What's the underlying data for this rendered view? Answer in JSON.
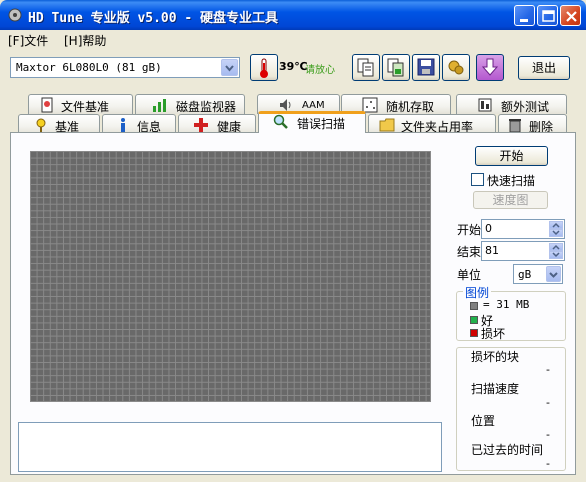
{
  "window": {
    "title": "HD Tune 专业版 v5.00 - 硬盘专业工具"
  },
  "menu": [
    {
      "label": "[F]文件"
    },
    {
      "label": "[H]帮助"
    }
  ],
  "toolbar": {
    "drive": "Maxtor 6L080L0 (81 gB)",
    "temperature": "39℃",
    "temperature_status": "请放心",
    "exit_label": "退出"
  },
  "tabs_top": [
    {
      "label": "文件基准",
      "icon": "file-benchmark-icon"
    },
    {
      "label": "磁盘监视器",
      "icon": "disk-monitor-icon"
    },
    {
      "label": "AAM",
      "icon": "speaker-icon"
    },
    {
      "label": "随机存取",
      "icon": "random-access-icon"
    },
    {
      "label": "额外测试",
      "icon": "extra-tests-icon"
    }
  ],
  "tabs_bottom": [
    {
      "label": "基准",
      "icon": "benchmark-icon"
    },
    {
      "label": "信息",
      "icon": "info-icon"
    },
    {
      "label": "健康",
      "icon": "health-icon"
    },
    {
      "label": "错误扫描",
      "icon": "magnifier-icon",
      "active": true
    },
    {
      "label": "文件夹占用率",
      "icon": "folder-icon"
    },
    {
      "label": "删除",
      "icon": "trash-icon"
    }
  ],
  "scan": {
    "start_button": "开始",
    "quick_scan_label": "快速扫描",
    "quick_scan_checked": false,
    "speed_map_button": "速度图",
    "start_label": "开始",
    "start_value": "0",
    "end_label": "结束",
    "end_value": "81",
    "unit_label": "单位",
    "unit_value": "gB"
  },
  "legend": {
    "title": "图例",
    "block_size": "= 31 MB",
    "good": "好",
    "bad": "损坏",
    "colors": {
      "block": "#808080",
      "good": "#22b14c",
      "bad": "#d00000"
    }
  },
  "stats": {
    "damaged_blocks_label": "损坏的块",
    "damaged_blocks_value": "-",
    "scan_speed_label": "扫描速度",
    "scan_speed_value": "-",
    "position_label": "位置",
    "position_value": "-",
    "elapsed_label": "已过去的时间",
    "elapsed_value": "-"
  }
}
